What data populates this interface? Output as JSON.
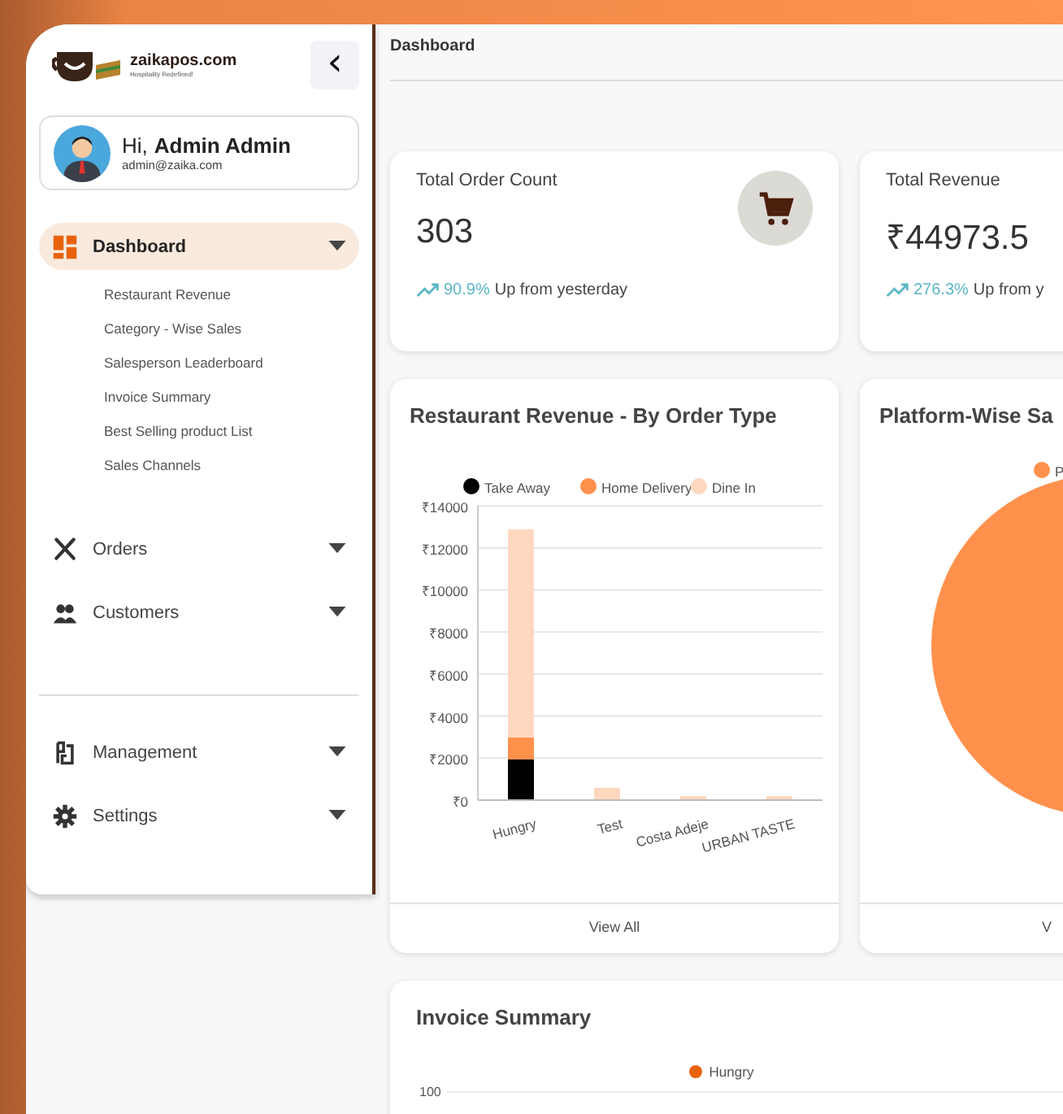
{
  "logo": {
    "name": "zaikapos.com",
    "tagline": "Hospitality Redefined!"
  },
  "collapse_button": {
    "label": "‹"
  },
  "user": {
    "greeting": "Hi,",
    "name": "Admin Admin",
    "email": "admin@zaika.com"
  },
  "nav_groups": [
    {
      "items": [
        {
          "label": "Dashboard",
          "kind": "dashboard",
          "selected": true,
          "children": [
            {
              "label": "Restaurant Revenue"
            },
            {
              "label": "Category - Wise Sales"
            },
            {
              "label": "Salesperson Leaderboard"
            },
            {
              "label": "Invoice Summary"
            },
            {
              "label": "Best Selling product List"
            },
            {
              "label": "Sales Channels"
            }
          ]
        },
        {
          "label": "Orders",
          "kind": "orders",
          "selected": false
        },
        {
          "label": "Customers",
          "kind": "customers",
          "selected": false
        }
      ]
    },
    {
      "items": [
        {
          "label": "Management",
          "kind": "management",
          "selected": false
        },
        {
          "label": "Settings",
          "kind": "settings",
          "selected": false
        }
      ]
    }
  ],
  "page_title": "Dashboard",
  "stat_cards": [
    {
      "title": "Total Order Count",
      "value": "303",
      "change": "90.9%",
      "change_text": "Up from yesterday",
      "kind": "count"
    },
    {
      "title": "Total Revenue",
      "value": "₹44973.5",
      "change": "276.3%",
      "change_text": "Up from y",
      "kind": "revenue"
    }
  ],
  "chart_cards": [
    {
      "title": "Restaurant Revenue - By Order Type",
      "footer": "View All",
      "chart_data": {
        "type": "bar",
        "stacked": true,
        "grid": true,
        "legend": "top",
        "categories": [
          "Hungry",
          "Test",
          "Costa Adeje",
          "URBAN TASTE"
        ],
        "series": [
          {
            "name": "Take Away",
            "color": "#000000",
            "values": [
              1900,
              0,
              0,
              0
            ]
          },
          {
            "name": "Home Delivery",
            "color": "#ff914d",
            "values": [
              1050,
              0,
              0,
              0
            ]
          },
          {
            "name": "Dine In",
            "color": "#ffd8bf",
            "values": [
              9900,
              550,
              150,
              150
            ]
          }
        ],
        "ylim": [
          0,
          14000
        ],
        "yticks": [
          {
            "value": 0,
            "label": "₹0"
          },
          {
            "value": 2000,
            "label": "₹2000"
          },
          {
            "value": 4000,
            "label": "₹4000"
          },
          {
            "value": 6000,
            "label": "₹6000"
          },
          {
            "value": 8000,
            "label": "₹8000"
          },
          {
            "value": 10000,
            "label": "₹10000"
          },
          {
            "value": 12000,
            "label": "₹12000"
          },
          {
            "value": 14000,
            "label": "₹14000"
          }
        ]
      }
    },
    {
      "title": "Platform-Wise Sa",
      "footer": "V",
      "chart_data": {
        "type": "pie",
        "legend": "top",
        "series": [
          {
            "name": "P",
            "color": "#ff914d",
            "values": [
              1
            ]
          }
        ]
      }
    }
  ],
  "invoice_summary": {
    "title": "Invoice Summary",
    "legend": [
      {
        "label": "Hungry",
        "color": "#e8620c"
      }
    ],
    "y_tick": "100"
  }
}
